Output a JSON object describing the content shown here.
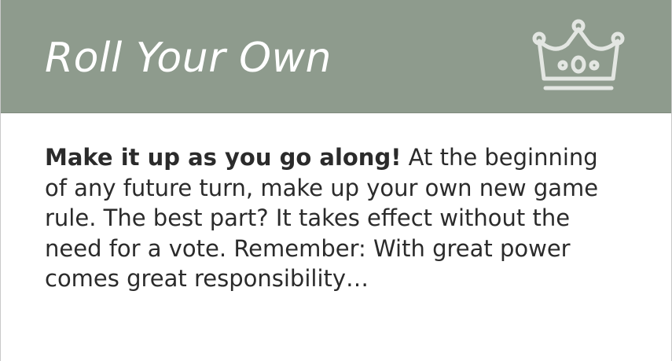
{
  "card": {
    "title": "Roll Your Own",
    "icon": "crown-icon",
    "lead": "Make it up as you go along!",
    "description": " At the beginning of any future turn, make up your own new game rule. The best part? It takes effect without the need for a vote. Remember: With great power comes great responsibility…",
    "colors": {
      "header": "#8e9b8d",
      "title": "#ffffff",
      "icon": "#e3e6e2",
      "text": "#2b2b2b"
    }
  }
}
